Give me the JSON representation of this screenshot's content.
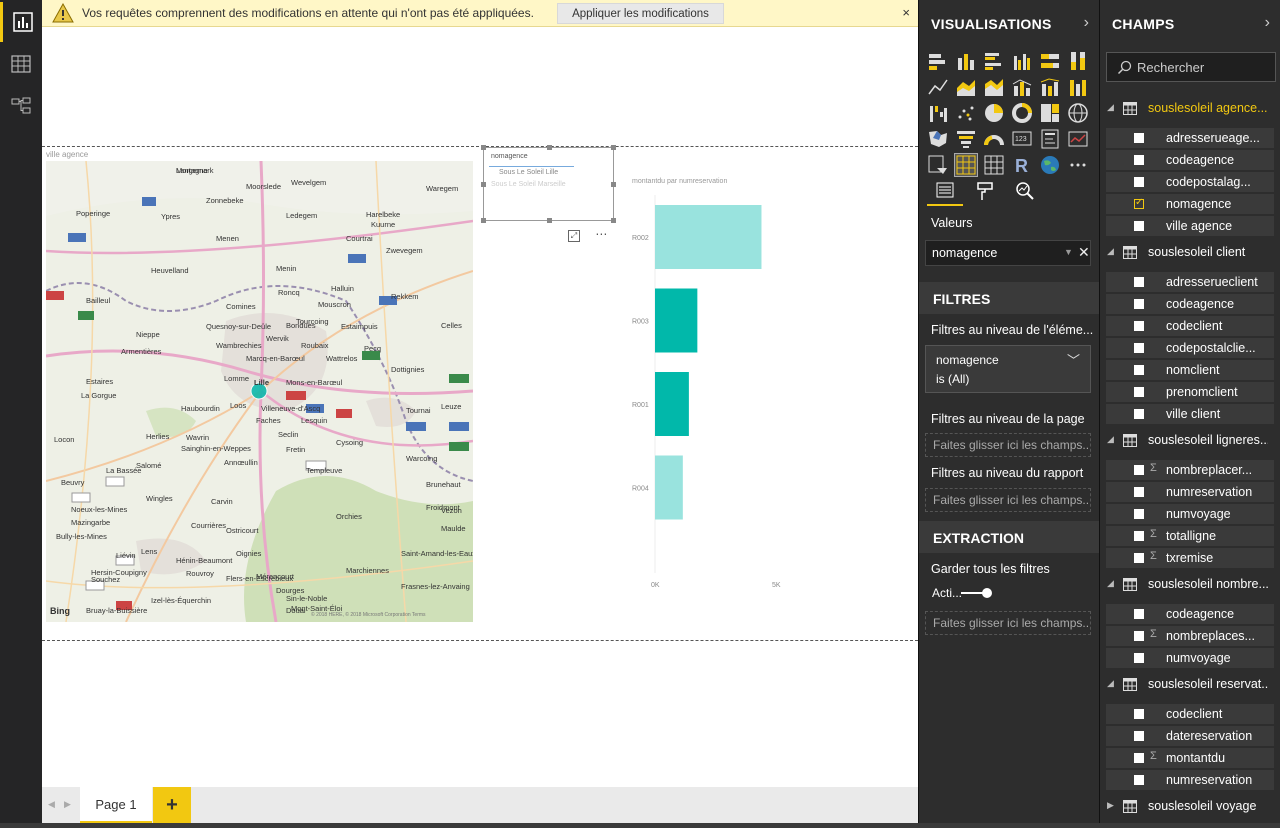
{
  "warning": {
    "message": "Vos requêtes comprennent des modifications en attente qui n'ont pas été appliquées.",
    "apply_label": "Appliquer les modifications",
    "close": "×"
  },
  "map_visual": {
    "title": "ville agence",
    "cities": [
      "Langemark",
      "Moorslede",
      "Wevelgem",
      "Waregem",
      "Poperinge",
      "Ypres",
      "Zonnebeke",
      "Ledegem",
      "Harelbeke",
      "Kuurne",
      "Courtrai",
      "Zwevegem",
      "Heuvelland",
      "Menin",
      "Roncq",
      "Mouscron",
      "Tourcoing",
      "Roubaix",
      "Wattrelos",
      "Estaimpuis",
      "Armentières",
      "Marcq-en-Barœul",
      "Lille",
      "Mons-en-Barœul",
      "Loos",
      "Villeneuve-d'Ascq",
      "Lomme",
      "Haubourdin",
      "Seclin",
      "Templeuve",
      "Orchies",
      "Lens",
      "Liévin",
      "Hénin-Beaumont",
      "Douai",
      "Marchiennes",
      "Carvin",
      "Bailleul",
      "Nieppe",
      "Pecq",
      "Celles",
      "Tournai",
      "Leuze",
      "Frasnes-lez-Anvaing",
      "Brunehaut",
      "Saint-Amand-les-Eaux",
      "Bruay-la-Buissière",
      "Mont-Saint-Éloi",
      "Sin-le-Noble",
      "Cysoing",
      "Fretin",
      "Wingles",
      "Annœullin",
      "Estaires",
      "La Gorgue",
      "Herlies",
      "Wavrin",
      "Locon",
      "La Bassée",
      "Beuvry",
      "Salomé",
      "Noeux-les-Mines",
      "Mazingarbe",
      "Bully-les-Mines",
      "Souchez",
      "Hersin-Coupigny",
      "Izel-lès-Équerchin",
      "Flers-en-Escrebieux",
      "Courrières",
      "Oignies",
      "Rouvroy",
      "Ostricourt",
      "Mérencourt",
      "Dourges",
      "Faches",
      "Lesquin",
      "Sainghin-en-Weppes",
      "Quesnoy-sur-Deûle",
      "Comines",
      "Wambrechies",
      "Halluin",
      "Bondues",
      "Wervik",
      "Menen",
      "Rekkem",
      "Dottignies",
      "Warcoing",
      "Froidmont",
      "Vezon",
      "Maulde",
      "Mortagne"
    ],
    "selected_city": "Lille",
    "attribution": "© 2018 HERE, © 2018 Microsoft Corporation  Terms",
    "logo": "Bing"
  },
  "slicer": {
    "title": "nomagence",
    "items": [
      "Sous Le Soleil   Lille",
      "Sous Le Soleil   Marseille"
    ]
  },
  "chart_data": {
    "type": "bar",
    "orientation": "horizontal",
    "title": "montantdu par numreservation",
    "categories": [
      "R002",
      "R003",
      "R001",
      "R004"
    ],
    "values": [
      4400,
      1750,
      1400,
      1150
    ],
    "colors": [
      "#99e3de",
      "#01b8aa",
      "#01b8aa",
      "#99e3de"
    ],
    "xlim": [
      0,
      5000
    ],
    "xticks": [
      "0K",
      "5K"
    ],
    "ylabel": "",
    "xlabel": "",
    "grid": false
  },
  "tabs": {
    "page1": "Page 1",
    "add": "+"
  },
  "visualisations": {
    "title": "VISUALISATIONS",
    "values_label": "Valeurs",
    "values_field": "nomagence"
  },
  "filters": {
    "title": "FILTRES",
    "element_level": "Filtres au niveau de l'éléme...",
    "card_field": "nomagence",
    "card_condition": "is (All)",
    "page_level": "Filtres au niveau de la page",
    "page_drop": "Faites glisser ici les champs...",
    "report_level": "Filtres au niveau du rapport",
    "report_drop": "Faites glisser ici les champs..."
  },
  "extraction": {
    "title": "EXTRACTION",
    "keep_filters": "Garder tous les filtres",
    "toggle_label": "Acti...",
    "drop": "Faites glisser ici les champs..."
  },
  "fields": {
    "title": "CHAMPS",
    "search_placeholder": "Rechercher",
    "tables": [
      {
        "name": "souslesoleil agence...",
        "highlighted": true,
        "fields": [
          {
            "name": "adresserueage...",
            "sigma": false,
            "checked": false
          },
          {
            "name": "codeagence",
            "sigma": false,
            "checked": false
          },
          {
            "name": "codepostalag...",
            "sigma": false,
            "checked": false
          },
          {
            "name": "nomagence",
            "sigma": false,
            "checked": true
          },
          {
            "name": "ville agence",
            "sigma": false,
            "checked": false
          }
        ]
      },
      {
        "name": "souslesoleil client",
        "highlighted": false,
        "fields": [
          {
            "name": "adresserueclient",
            "sigma": false,
            "checked": false
          },
          {
            "name": "codeagence",
            "sigma": false,
            "checked": false
          },
          {
            "name": "codeclient",
            "sigma": false,
            "checked": false
          },
          {
            "name": "codepostalclie...",
            "sigma": false,
            "checked": false
          },
          {
            "name": "nomclient",
            "sigma": false,
            "checked": false
          },
          {
            "name": "prenomclient",
            "sigma": false,
            "checked": false
          },
          {
            "name": "ville client",
            "sigma": false,
            "checked": false
          }
        ]
      },
      {
        "name": "souslesoleil ligneres...",
        "highlighted": false,
        "fields": [
          {
            "name": "nombreplacer...",
            "sigma": true,
            "checked": false
          },
          {
            "name": "numreservation",
            "sigma": false,
            "checked": false
          },
          {
            "name": "numvoyage",
            "sigma": false,
            "checked": false
          },
          {
            "name": "totalligne",
            "sigma": true,
            "checked": false
          },
          {
            "name": "txremise",
            "sigma": true,
            "checked": false
          }
        ]
      },
      {
        "name": "souslesoleil nombre...",
        "highlighted": false,
        "fields": [
          {
            "name": "codeagence",
            "sigma": false,
            "checked": false
          },
          {
            "name": "nombreplaces...",
            "sigma": true,
            "checked": false
          },
          {
            "name": "numvoyage",
            "sigma": false,
            "checked": false
          }
        ]
      },
      {
        "name": "souslesoleil reservat...",
        "highlighted": false,
        "fields": [
          {
            "name": "codeclient",
            "sigma": false,
            "checked": false
          },
          {
            "name": "datereservation",
            "sigma": false,
            "checked": false
          },
          {
            "name": "montantdu",
            "sigma": true,
            "checked": false
          },
          {
            "name": "numreservation",
            "sigma": false,
            "checked": false
          }
        ]
      },
      {
        "name": "souslesoleil voyage",
        "highlighted": false,
        "collapsed": true,
        "fields": []
      }
    ]
  },
  "colors": {
    "accent": "#f2c811",
    "teal": "#01b8aa",
    "teal_light": "#99e3de"
  }
}
